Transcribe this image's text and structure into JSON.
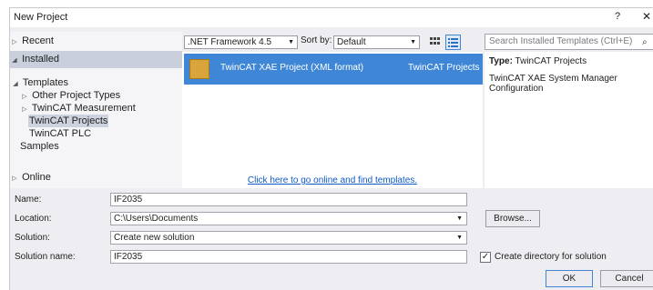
{
  "window": {
    "title": "New Project",
    "help_label": "?",
    "close_label": "✕"
  },
  "tree": {
    "recent": "Recent",
    "installed": "Installed",
    "templates": "Templates",
    "other_project_types": "Other Project Types",
    "twincat_measurement": "TwinCAT Measurement",
    "twincat_projects": "TwinCAT Projects",
    "twincat_plc": "TwinCAT PLC",
    "samples": "Samples",
    "online": "Online"
  },
  "toolbar": {
    "framework": ".NET Framework 4.5",
    "sort_label": "Sort by:",
    "sort_value": "Default"
  },
  "search": {
    "placeholder": "Search Installed Templates (Ctrl+E)"
  },
  "templates": [
    {
      "name": "TwinCAT XAE Project (XML format)",
      "category": "TwinCAT Projects"
    }
  ],
  "online_link": "Click here to go online and find templates.",
  "details": {
    "type_label": "Type:",
    "type_value": "TwinCAT Projects",
    "description": "TwinCAT XAE System Manager Configuration"
  },
  "form": {
    "name_label": "Name:",
    "name_value": "IF2035",
    "location_label": "Location:",
    "location_value": "C:\\Users\\Documents",
    "solution_label": "Solution:",
    "solution_value": "Create new solution",
    "solution_name_label": "Solution name:",
    "solution_name_value": "IF2035",
    "browse_label": "Browse...",
    "create_dir_label": "Create directory for solution",
    "create_dir_checked": true,
    "ok_label": "OK",
    "cancel_label": "Cancel"
  },
  "colors": {
    "accent": "#3f87d6",
    "link": "#0e5ac4",
    "panel": "#eeeef2"
  }
}
